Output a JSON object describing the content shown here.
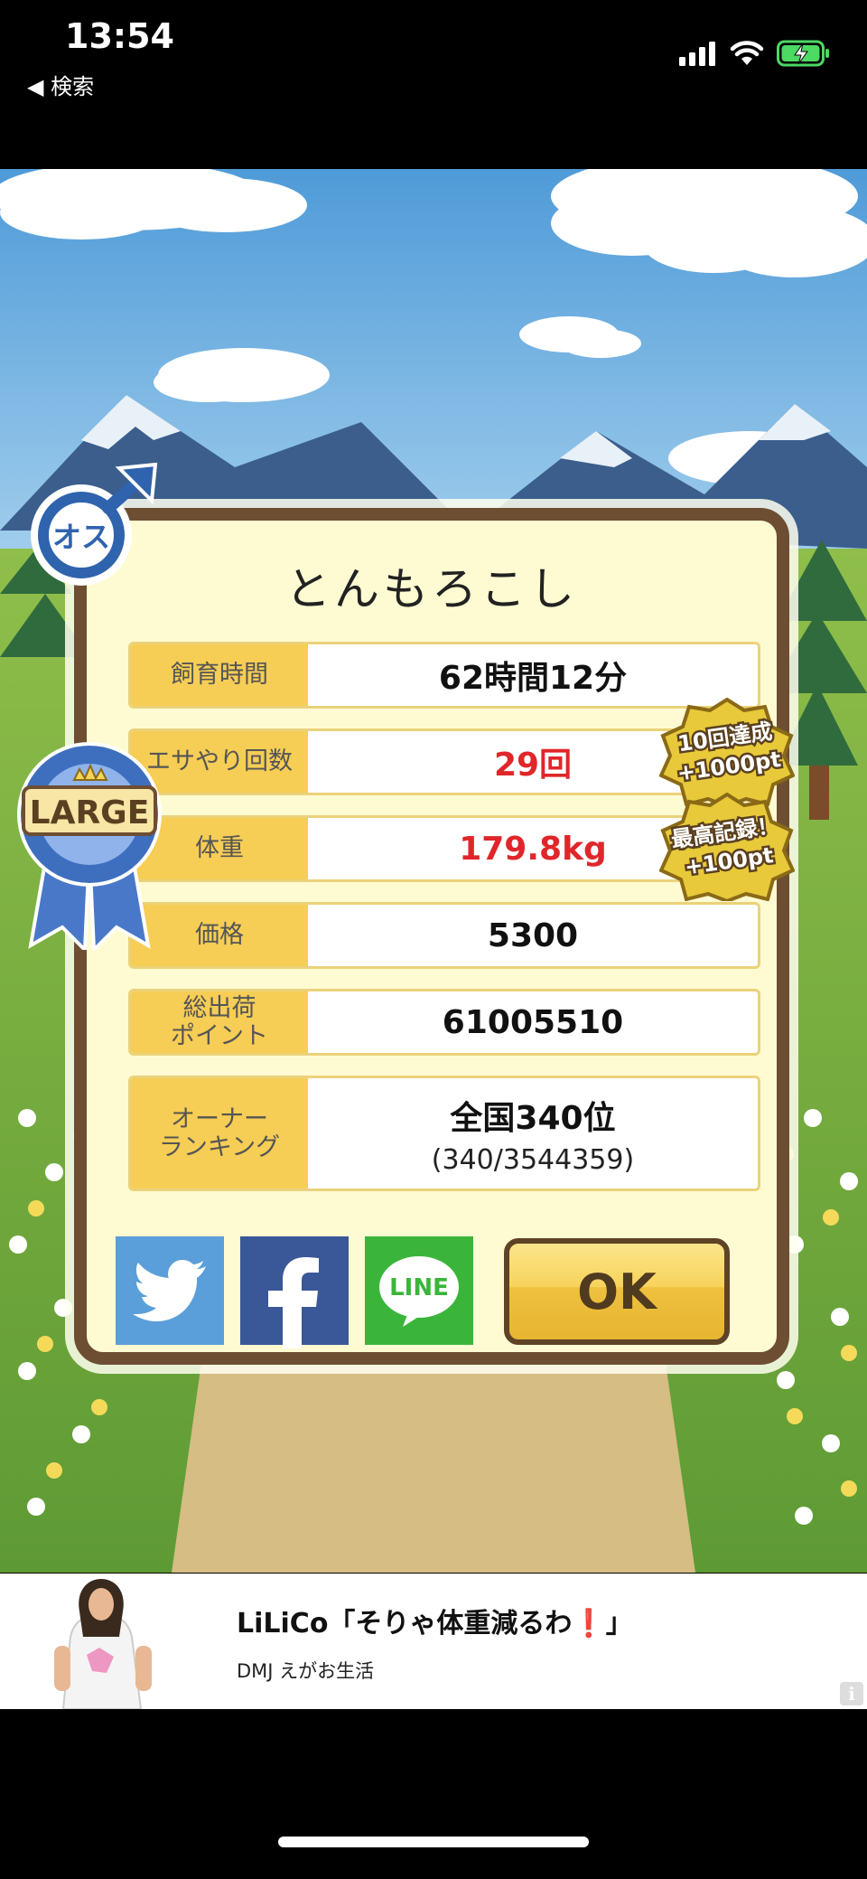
{
  "status": {
    "time": "13:54",
    "back_label": "◀ 検索"
  },
  "pig": {
    "name": "とんもろこし",
    "gender_badge": "オス",
    "size_badge": "LARGE"
  },
  "stats": [
    {
      "label": "飼育時間",
      "value": "62時間12分"
    },
    {
      "label": "エサやり回数",
      "value": "29回"
    },
    {
      "label": "体重",
      "value": "179.8kg"
    },
    {
      "label": "価格",
      "value": "5300"
    },
    {
      "label": "総出荷\nポイント",
      "value": "61005510"
    },
    {
      "label": "オーナー\nランキング",
      "value": "全国340位",
      "sub": "(340/3544359)"
    }
  ],
  "achievements": [
    {
      "line1": "10回達成",
      "line2": "+1000pt"
    },
    {
      "line1": "最高記録！",
      "line2": "+100pt"
    }
  ],
  "share": {
    "line_label": "LINE"
  },
  "ok_label": "OK",
  "ad": {
    "title": "LiLiCo「そりゃ体重減るわ❗」",
    "subtitle": "DMJ えがお生活",
    "info": "i"
  },
  "colors": {
    "value_red": "#e0262a",
    "label_bg": "#f6cd55",
    "twitter": "#5a9fd9",
    "facebook": "#3a5798",
    "line": "#3ab53a"
  }
}
